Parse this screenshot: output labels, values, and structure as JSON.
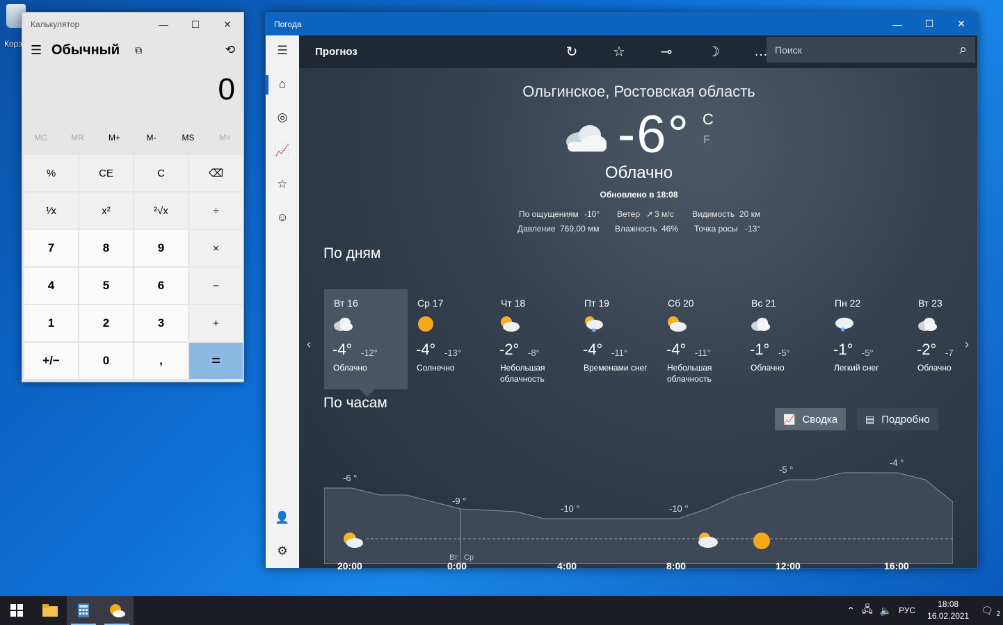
{
  "desktop": {
    "icon_label": "Корзина"
  },
  "calculator": {
    "title": "Калькулятор",
    "mode": "Обычный",
    "display": "0",
    "memory": [
      "MC",
      "MR",
      "M+",
      "M-",
      "MS",
      "M˅"
    ],
    "keys": [
      "%",
      "CE",
      "C",
      "⌫",
      "¹⁄x",
      "x²",
      "²√x",
      "÷",
      "7",
      "8",
      "9",
      "×",
      "4",
      "5",
      "6",
      "−",
      "1",
      "2",
      "3",
      "+",
      "+/−",
      "0",
      ",",
      "="
    ]
  },
  "weather": {
    "title": "Погода",
    "toolbar_title": "Прогноз",
    "search_placeholder": "Поиск",
    "location": "Ольгинское, Ростовская область",
    "temp": "-6°",
    "unit_c": "C",
    "unit_f": "F",
    "condition": "Облачно",
    "updated": "Обновлено в 18:08",
    "details": {
      "feels_label": "По ощущениям",
      "feels": "-10°",
      "wind_label": "Ветер",
      "wind": "3 м/с",
      "visibility_label": "Видимость",
      "visibility": "20 км",
      "pressure_label": "Давление",
      "pressure": "769,00 мм",
      "humidity_label": "Влажность",
      "humidity": "46%",
      "dew_label": "Точка росы",
      "dew": "-13°"
    },
    "daily_title": "По дням",
    "days": [
      {
        "name": "Вт 16",
        "hi": "-4°",
        "lo": "-12°",
        "cond": "Облачно",
        "icon": "cloud"
      },
      {
        "name": "Ср 17",
        "hi": "-4°",
        "lo": "-13°",
        "cond": "Солнечно",
        "icon": "sun"
      },
      {
        "name": "Чт 18",
        "hi": "-2°",
        "lo": "-8°",
        "cond": "Небольшая облачность",
        "icon": "partly"
      },
      {
        "name": "Пт 19",
        "hi": "-4°",
        "lo": "-11°",
        "cond": "Временами снег",
        "icon": "snow-partly"
      },
      {
        "name": "Сб 20",
        "hi": "-4°",
        "lo": "-11°",
        "cond": "Небольшая облачность",
        "icon": "partly"
      },
      {
        "name": "Вс 21",
        "hi": "-1°",
        "lo": "-5°",
        "cond": "Облачно",
        "icon": "cloud"
      },
      {
        "name": "Пн 22",
        "hi": "-1°",
        "lo": "-5°",
        "cond": "Легкий снег",
        "icon": "snow"
      },
      {
        "name": "Вт 23",
        "hi": "-2°",
        "lo": "-7",
        "cond": "Облачно",
        "icon": "cloud"
      }
    ],
    "hourly_title": "По часам",
    "btn_summary": "Сводка",
    "btn_detail": "Подробно",
    "hourly": {
      "temp_labels": [
        "-6 °",
        "-9 °",
        "-10 °",
        "-10 °",
        "-5 °",
        "-4 °"
      ],
      "time_labels": [
        "20:00",
        "0:00",
        "4:00",
        "8:00",
        "12:00",
        "16:00"
      ],
      "day_change": [
        "Вт",
        "Ср"
      ]
    }
  },
  "taskbar": {
    "lang": "РУС",
    "time": "18:08",
    "date": "16.02.2021",
    "notif_count": "2"
  }
}
